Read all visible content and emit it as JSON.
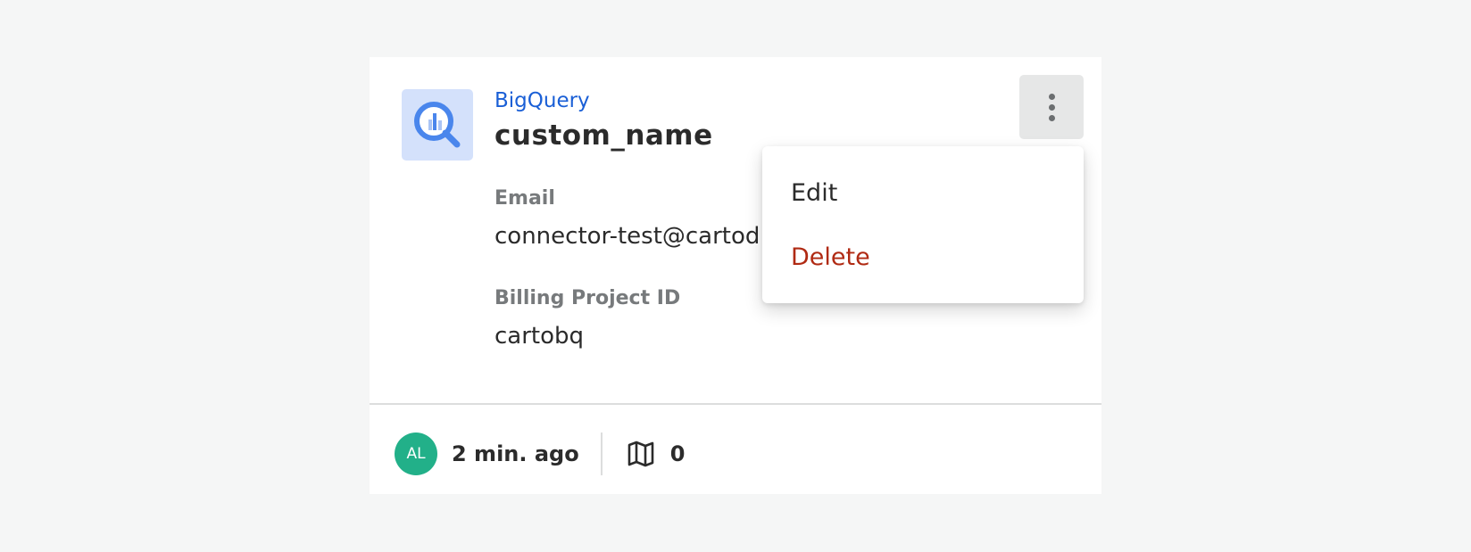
{
  "connection": {
    "provider": "BigQuery",
    "provider_icon": "bigquery-icon",
    "name": "custom_name",
    "fields": [
      {
        "label": "Email",
        "value": "connector-test@cartod"
      },
      {
        "label": "Billing Project ID",
        "value": "cartobq"
      }
    ]
  },
  "footer": {
    "avatar_initials": "AL",
    "avatar_color": "#22b089",
    "timestamp": "2 min. ago",
    "map_icon": "map-icon",
    "map_count": "0"
  },
  "menu": {
    "trigger_icon": "more-vertical-icon",
    "items": [
      {
        "label": "Edit",
        "color": "#2b2b2b"
      },
      {
        "label": "Delete",
        "color": "#b02a13"
      }
    ]
  },
  "colors": {
    "accent": "#1a5fd6",
    "danger": "#b02a13",
    "background": "#f5f6f6"
  }
}
